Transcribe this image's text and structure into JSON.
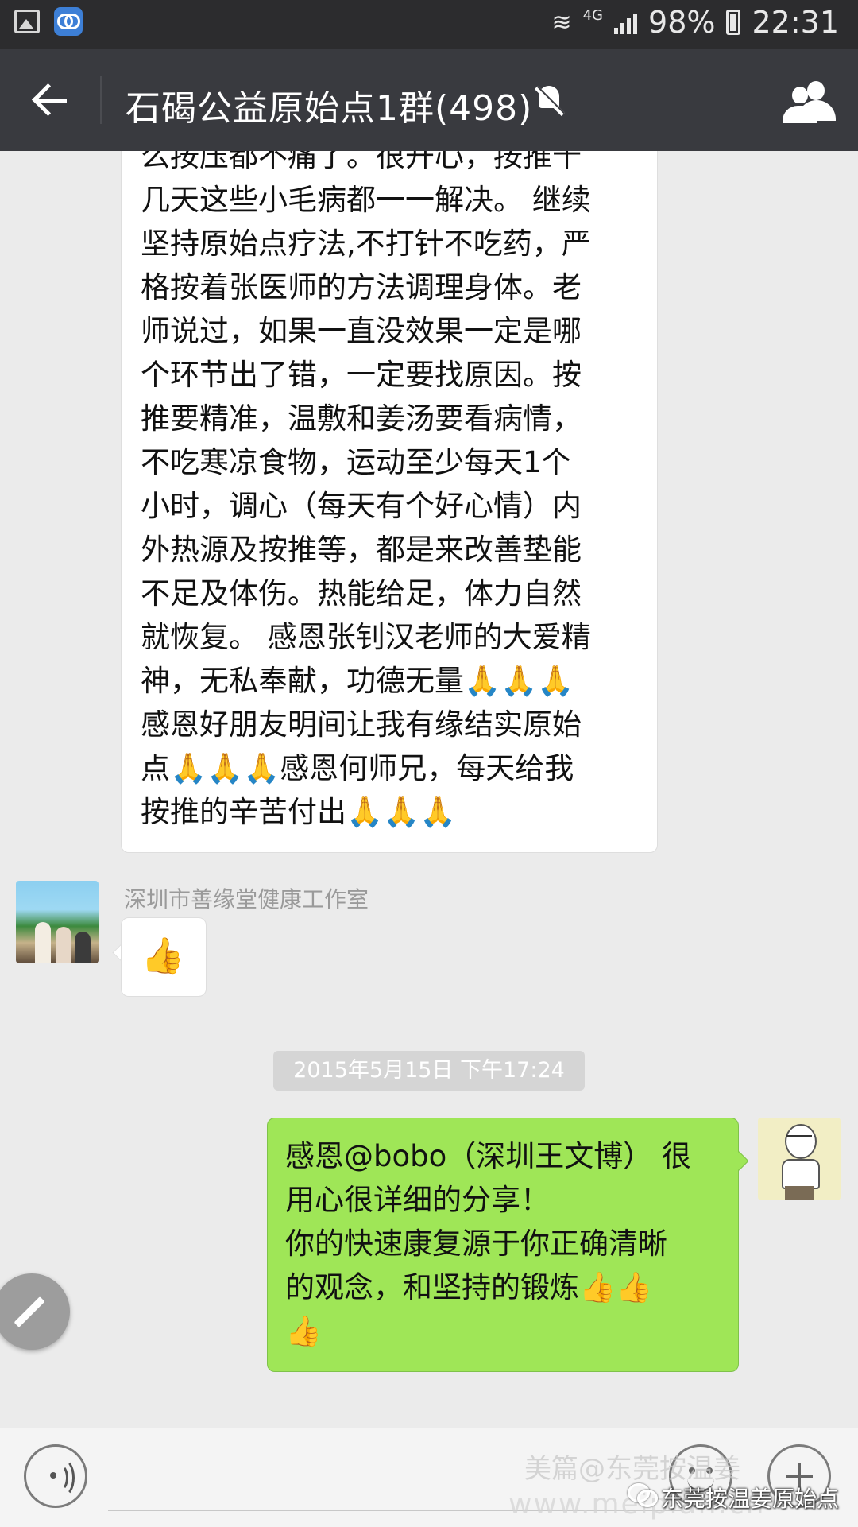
{
  "status_bar": {
    "network": "4G",
    "battery": "98%",
    "time": "22:31"
  },
  "header": {
    "title": "石碣公益原始点1群(498)"
  },
  "messages": {
    "long_message_lines": [
      "么按压都不痛了。很开心，按推十",
      "几天这些小毛病都一一解决。  继续",
      "坚持原始点疗法,不打针不吃药，严",
      "格按着张医师的方法调理身体。老",
      "师说过，如果一直没效果一定是哪",
      "个环节出了错，一定要找原因。按",
      "推要精准，温敷和姜汤要看病情，",
      "不吃寒凉食物，运动至少每天1个",
      "小时，调心（每天有个好心情）内",
      "外热源及按推等，都是来改善垫能",
      "不足及体伤。热能给足，体力自然",
      "就恢复。 感恩张钊汉老师的大爱精",
      "神，无私奉献，功德无量🙏🙏🙏",
      "感恩好朋友明间让我有缘结实原始",
      "点🙏🙏🙏感恩何师兄，每天给我",
      "按推的辛苦付出🙏🙏🙏"
    ],
    "sender_name": "深圳市善缘堂健康工作室",
    "thumbs_message": "👍",
    "timestamp": "2015年5月15日 下午17:24",
    "my_message_lines": [
      "感恩@bobo（深圳王文博） 很",
      "用心很详细的分享！",
      "你的快速康复源于你正确清晰",
      "的观念，和坚持的锻炼👍👍",
      "👍"
    ]
  },
  "watermark": {
    "faint_text": "美篇@东莞按温姜",
    "url": "www.meipian.cn",
    "account": "东莞按温姜原始点"
  },
  "colors": {
    "status_bar": "#2c2c2e",
    "title_bar": "#393a3f",
    "chat_background": "#ebebeb",
    "incoming_bubble": "#ffffff",
    "outgoing_bubble": "#9fe657"
  },
  "icons": {
    "back": "back-arrow-icon",
    "mute": "bell-off-icon",
    "group": "group-members-icon",
    "edit": "pencil-icon",
    "voice": "voice-icon",
    "emoji": "emoji-icon",
    "more": "plus-icon"
  }
}
